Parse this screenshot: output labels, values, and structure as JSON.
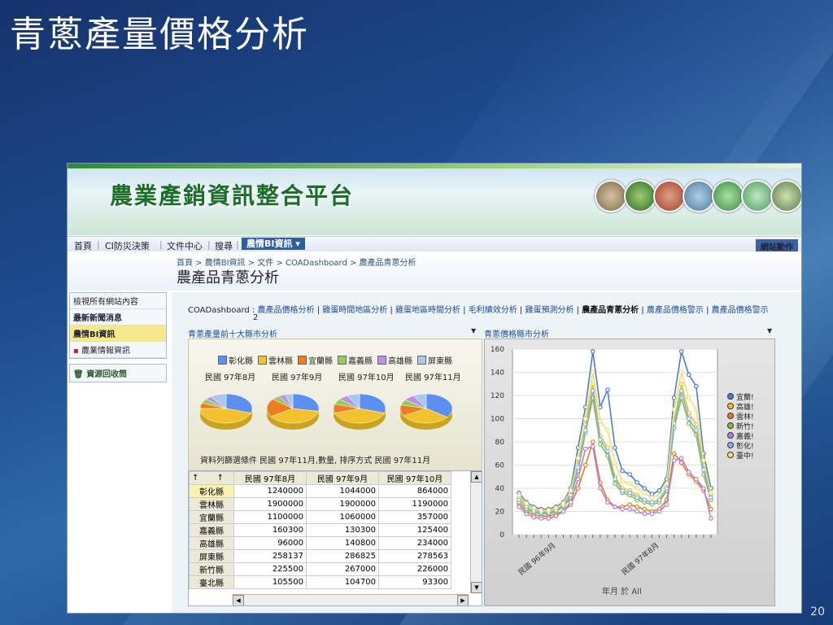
{
  "slide": {
    "title": "青蔥產量價格分析",
    "page_number": "20"
  },
  "site": {
    "title": "農業產銷資訊整合平台",
    "nav": {
      "items": [
        "首頁",
        "CI防災決策",
        "文件中心",
        "搜尋"
      ],
      "active": "農情BI資訊 ▾",
      "site_actions": "網站動作"
    },
    "breadcrumb": "首頁 > 農情BI資訊 > 文件 > COADashboard > 農產品青蔥分析",
    "page_title": "農產品青蔥分析",
    "left_nav": {
      "view_all": "檢視所有網站內容",
      "news": "最新新聞消息",
      "bi": "農情BI資訊",
      "sub": "農業情報資訊",
      "recycle": "資源回收筒"
    },
    "coa": {
      "prefix": "COADashboard :",
      "links": [
        "農產品價格分析",
        "雞蛋時間地區分析",
        "雞蛋地區時間分析",
        "毛利績效分析",
        "雞蛋預測分析"
      ],
      "current": "農產品青蔥分析",
      "more": [
        "農產品價格警示",
        "農產品價格警示"
      ],
      "continuation": "2"
    }
  },
  "production": {
    "title": "青蔥產量前十大縣市分析",
    "legend": [
      {
        "name": "彰化縣",
        "color": "#5b8ff0"
      },
      {
        "name": "雲林縣",
        "color": "#f2c12e"
      },
      {
        "name": "宜蘭縣",
        "color": "#f07c1e"
      },
      {
        "name": "嘉義縣",
        "color": "#8fce5c"
      },
      {
        "name": "高雄縣",
        "color": "#c28fe6"
      },
      {
        "name": "屏東縣",
        "color": "#a8c8f0"
      }
    ],
    "months": [
      "民國 97年8月",
      "民國 97年9月",
      "民國 97年10月",
      "民國 97年11月"
    ],
    "filter": "資料列篩選條件 民國 97年11月,數量, 排序方式 民國 97年11月",
    "columns": [
      "民國 97年8月",
      "民國 97年9月",
      "民國 97年10月"
    ],
    "rows": [
      {
        "county": "彰化縣",
        "values": [
          "1240000",
          "1044000",
          "864000"
        ]
      },
      {
        "county": "雲林縣",
        "values": [
          "1900000",
          "1900000",
          "1190000"
        ]
      },
      {
        "county": "宜蘭縣",
        "values": [
          "1100000",
          "1060000",
          "357000"
        ]
      },
      {
        "county": "嘉義縣",
        "values": [
          "160300",
          "130300",
          "125400"
        ]
      },
      {
        "county": "高雄縣",
        "values": [
          "96000",
          "140800",
          "234000"
        ]
      },
      {
        "county": "屏東縣",
        "values": [
          "258137",
          "286825",
          "278563"
        ]
      },
      {
        "county": "新竹縣",
        "values": [
          "225500",
          "267000",
          "226000"
        ]
      },
      {
        "county": "臺北縣",
        "values": [
          "105500",
          "104700",
          "93300"
        ]
      }
    ]
  },
  "chart_data": {
    "type": "line",
    "title": "青蔥價格縣市分析",
    "xlabel": "年月 於 All",
    "ylabel": "",
    "ylim": [
      0,
      160
    ],
    "yticks": [
      0,
      20,
      40,
      60,
      80,
      100,
      120,
      140,
      160
    ],
    "x_tick_labels": [
      "民國 96年9月",
      "民國 97年8月"
    ],
    "series": [
      {
        "name": "宜蘭!",
        "color": "#4a7fd0",
        "values": [
          36,
          28,
          24,
          22,
          22,
          24,
          28,
          40,
          75,
          110,
          158,
          110,
          125,
          75,
          55,
          52,
          45,
          40,
          35,
          38,
          48,
          118,
          158,
          138,
          128,
          70,
          40
        ]
      },
      {
        "name": "高雄!",
        "color": "#f0c020",
        "values": [
          32,
          26,
          22,
          20,
          20,
          22,
          26,
          36,
          60,
          95,
          130,
          85,
          75,
          50,
          40,
          38,
          34,
          30,
          28,
          30,
          40,
          98,
          130,
          105,
          95,
          60,
          34
        ]
      },
      {
        "name": "雲林!",
        "color": "#f07820",
        "values": [
          26,
          20,
          17,
          16,
          16,
          18,
          20,
          26,
          40,
          60,
          80,
          45,
          30,
          24,
          24,
          26,
          24,
          22,
          20,
          22,
          30,
          70,
          62,
          52,
          46,
          38,
          22
        ]
      },
      {
        "name": "新竹!",
        "color": "#80c040",
        "values": [
          28,
          22,
          19,
          18,
          18,
          20,
          24,
          32,
          55,
          88,
          118,
          78,
          68,
          44,
          36,
          34,
          30,
          28,
          26,
          28,
          38,
          92,
          118,
          96,
          86,
          52,
          30
        ]
      },
      {
        "name": "嘉義!",
        "color": "#b080e0",
        "values": [
          24,
          18,
          15,
          14,
          14,
          16,
          20,
          28,
          48,
          74,
          76,
          40,
          28,
          24,
          22,
          22,
          20,
          18,
          18,
          20,
          26,
          64,
          66,
          54,
          48,
          40,
          14
        ]
      },
      {
        "name": "彰化!",
        "color": "#80b0f0",
        "values": [
          30,
          24,
          20,
          19,
          19,
          21,
          25,
          34,
          58,
          90,
          124,
          82,
          72,
          48,
          38,
          36,
          32,
          30,
          28,
          30,
          40,
          96,
          124,
          100,
          90,
          56,
          32
        ]
      },
      {
        "name": "臺中!",
        "color": "#f0e070",
        "values": [
          34,
          27,
          23,
          21,
          21,
          23,
          27,
          38,
          66,
          100,
          140,
          98,
          90,
          62,
          46,
          44,
          40,
          36,
          32,
          34,
          44,
          108,
          140,
          118,
          108,
          64,
          36
        ]
      }
    ]
  }
}
